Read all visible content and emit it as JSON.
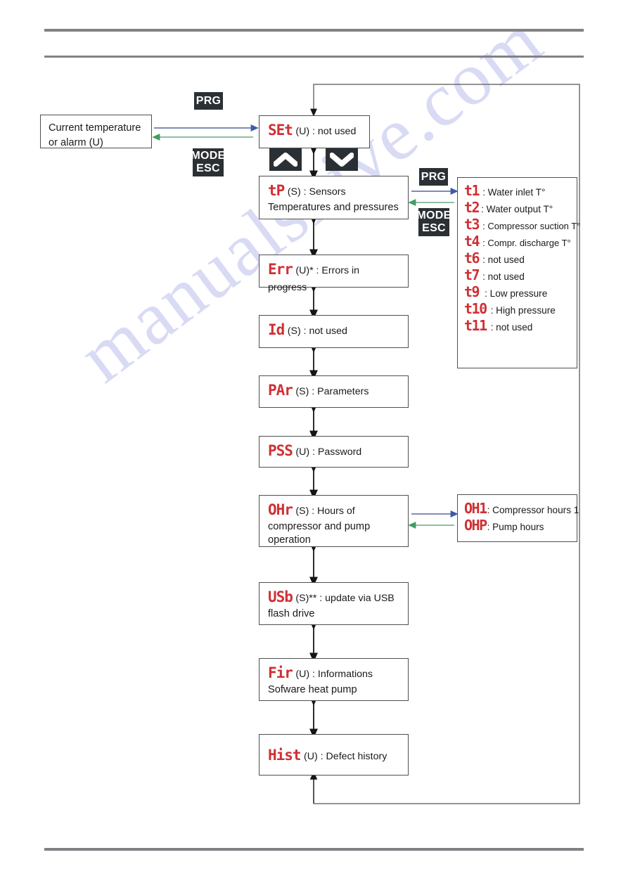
{
  "page": {
    "watermark": "manualshive.com"
  },
  "start_box": {
    "line1": "Current temperature",
    "line2": "or alarm (U)"
  },
  "keys": {
    "prg": "PRG",
    "mode": "MODE",
    "esc": "ESC",
    "up_icon": "chevron-up-icon",
    "down_icon": "chevron-down-icon"
  },
  "menu": [
    {
      "code": "SEt",
      "desc": "(U) : not used",
      "line2": ""
    },
    {
      "code": "tP",
      "desc": "(S) : Sensors",
      "line2": "Temperatures and pressures"
    },
    {
      "code": "Err",
      "desc": "(U)* : Errors in progress",
      "line2": ""
    },
    {
      "code": "Id",
      "desc": "(S) : not used",
      "line2": ""
    },
    {
      "code": "PAr",
      "desc": "(S) : Parameters",
      "line2": ""
    },
    {
      "code": "PSS",
      "desc": "(U) : Password",
      "line2": ""
    },
    {
      "code": "OHr",
      "desc": "(S) : Hours of",
      "line2": "compressor and pump operation"
    },
    {
      "code": "USb",
      "desc": "(S)** : update via USB",
      "line2": "flash drive"
    },
    {
      "code": "Fir",
      "desc": "(U) : Informations",
      "line2": "Sofware heat pump"
    },
    {
      "code": "Hist",
      "desc": "(U) : Defect history",
      "line2": ""
    }
  ],
  "sensors": [
    {
      "code": "t1",
      "desc": ": Water inlet T°"
    },
    {
      "code": "t2",
      "desc": ": Water output T°"
    },
    {
      "code": "t3",
      "desc": ": Compressor suction T°"
    },
    {
      "code": "t4",
      "desc": ": Compr. discharge T°"
    },
    {
      "code": "t6",
      "desc": ": not used"
    },
    {
      "code": "t7",
      "desc": ": not used"
    },
    {
      "code": "t9",
      "desc": ": Low pressure"
    },
    {
      "code": "t10",
      "desc": ": High pressure"
    },
    {
      "code": "t11",
      "desc": ": not used"
    }
  ],
  "hours": [
    {
      "code": "OH1",
      "desc": ": Compressor hours 1"
    },
    {
      "code": "OHP",
      "desc": ": Pump hours"
    }
  ],
  "colors": {
    "code_red": "#cf3034",
    "key_bg": "#2b3034",
    "enter_arrow": "#3b5ca8",
    "exit_arrow": "#3f9e62",
    "box_border": "#4f4f4f",
    "rule": "#808285",
    "watermark": "#c3c6ef"
  }
}
